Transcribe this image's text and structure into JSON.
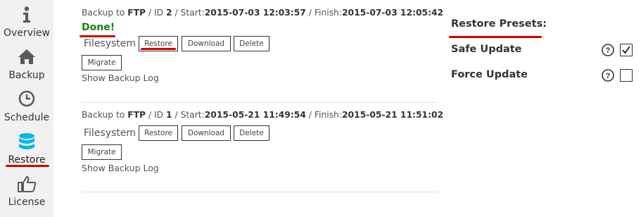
{
  "sidebar": {
    "items": [
      {
        "label": "Overview",
        "icon": "info-icon"
      },
      {
        "label": "Backup",
        "icon": "home-icon"
      },
      {
        "label": "Schedule",
        "icon": "clock-icon"
      },
      {
        "label": "Restore",
        "icon": "database-icon",
        "active": true
      },
      {
        "label": "License",
        "icon": "thumbs-up-icon"
      }
    ]
  },
  "backups": [
    {
      "prefix": "Backup to ",
      "target": "FTP",
      "id_label": " / ID ",
      "id": "2",
      "start_label": " / Start:",
      "start": "2015-07-03 12:03:57",
      "finish_label": " / Finish:",
      "finish": "2015-07-03 12:05:42",
      "status": "Done!",
      "type": "Filesystem",
      "restore": "Restore",
      "download": "Download",
      "delete": "Delete",
      "migrate": "Migrate",
      "log": "Show Backup Log"
    },
    {
      "prefix": "Backup to ",
      "target": "FTP",
      "id_label": " / ID ",
      "id": "1",
      "start_label": " / Start:",
      "start": "2015-05-21 11:49:54",
      "finish_label": " / Finish:",
      "finish": "2015-05-21 11:51:02",
      "type": "Filesystem",
      "restore": "Restore",
      "download": "Download",
      "delete": "Delete",
      "migrate": "Migrate",
      "log": "Show Backup Log"
    }
  ],
  "presets": {
    "title": "Restore Presets:",
    "items": [
      {
        "label": "Safe Update",
        "checked": true
      },
      {
        "label": "Force Update",
        "checked": false
      }
    ]
  },
  "colors": {
    "accent_underline": "#d40000",
    "active_icon": "#00b9eb",
    "done": "#1a7f1a"
  }
}
